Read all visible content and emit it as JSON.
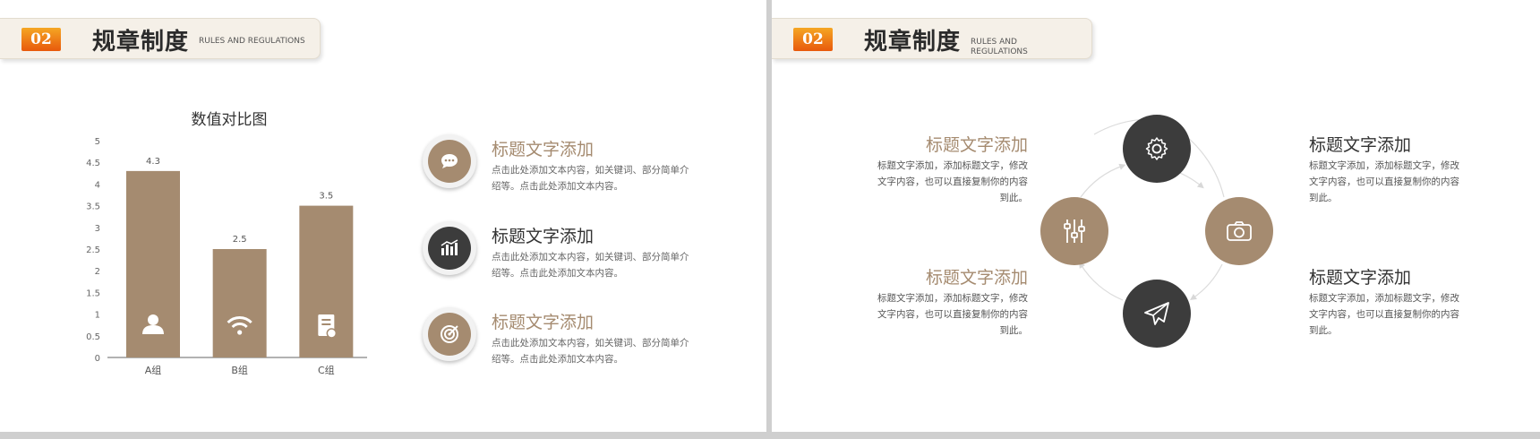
{
  "colors": {
    "brown": "#a58b70",
    "dark": "#3c3c3c",
    "axis": "#999999"
  },
  "left": {
    "header": {
      "number": "02",
      "title": "规章制度",
      "subtitle": "RULES AND REGULATIONS"
    },
    "items": [
      {
        "title": "标题文字添加",
        "text": "点击此处添加文本内容，如关键词、部分简单介绍等。点击此处添加文本内容。",
        "icon": "chat-bubble-icon"
      },
      {
        "title": "标题文字添加",
        "text": "点击此处添加文本内容，如关键词、部分简单介绍等。点击此处添加文本内容。",
        "icon": "bar-chart-icon"
      },
      {
        "title": "标题文字添加",
        "text": "点击此处添加文本内容，如关键词、部分简单介绍等。点击此处添加文本内容。",
        "icon": "target-icon"
      }
    ]
  },
  "chart_data": {
    "type": "bar",
    "title": "数值对比图",
    "categories": [
      "A组",
      "B组",
      "C组"
    ],
    "values": [
      4.3,
      2.5,
      3.5
    ],
    "value_labels": [
      "4.3",
      "2.5",
      "3.5"
    ],
    "yticks": [
      "0",
      "0.5",
      "1",
      "1.5",
      "2",
      "2.5",
      "3",
      "3.5",
      "4",
      "4.5",
      "5"
    ],
    "ylim": [
      0,
      5
    ],
    "grid": false,
    "bar_icons": [
      "user-icon",
      "wifi-icon",
      "document-icon"
    ]
  },
  "right": {
    "header": {
      "number": "02",
      "title": "规章制度",
      "subtitle": "RULES AND REGULATIONS"
    },
    "blocks": [
      {
        "title": "标题文字添加",
        "text": "标题文字添加，添加标题文字，修改文字内容，也可以直接复制你的内容到此。"
      },
      {
        "title": "标题文字添加",
        "text": "标题文字添加，添加标题文字，修改文字内容，也可以直接复制你的内容到此。"
      },
      {
        "title": "标题文字添加",
        "text": "标题文字添加，添加标题文字，修改文字内容，也可以直接复制你的内容到此。"
      },
      {
        "title": "标题文字添加",
        "text": "标题文字添加，添加标题文字，修改文字内容，也可以直接复制你的内容到此。"
      }
    ],
    "nodes": [
      "gear-icon",
      "camera-icon",
      "paper-plane-icon",
      "sliders-icon"
    ]
  }
}
